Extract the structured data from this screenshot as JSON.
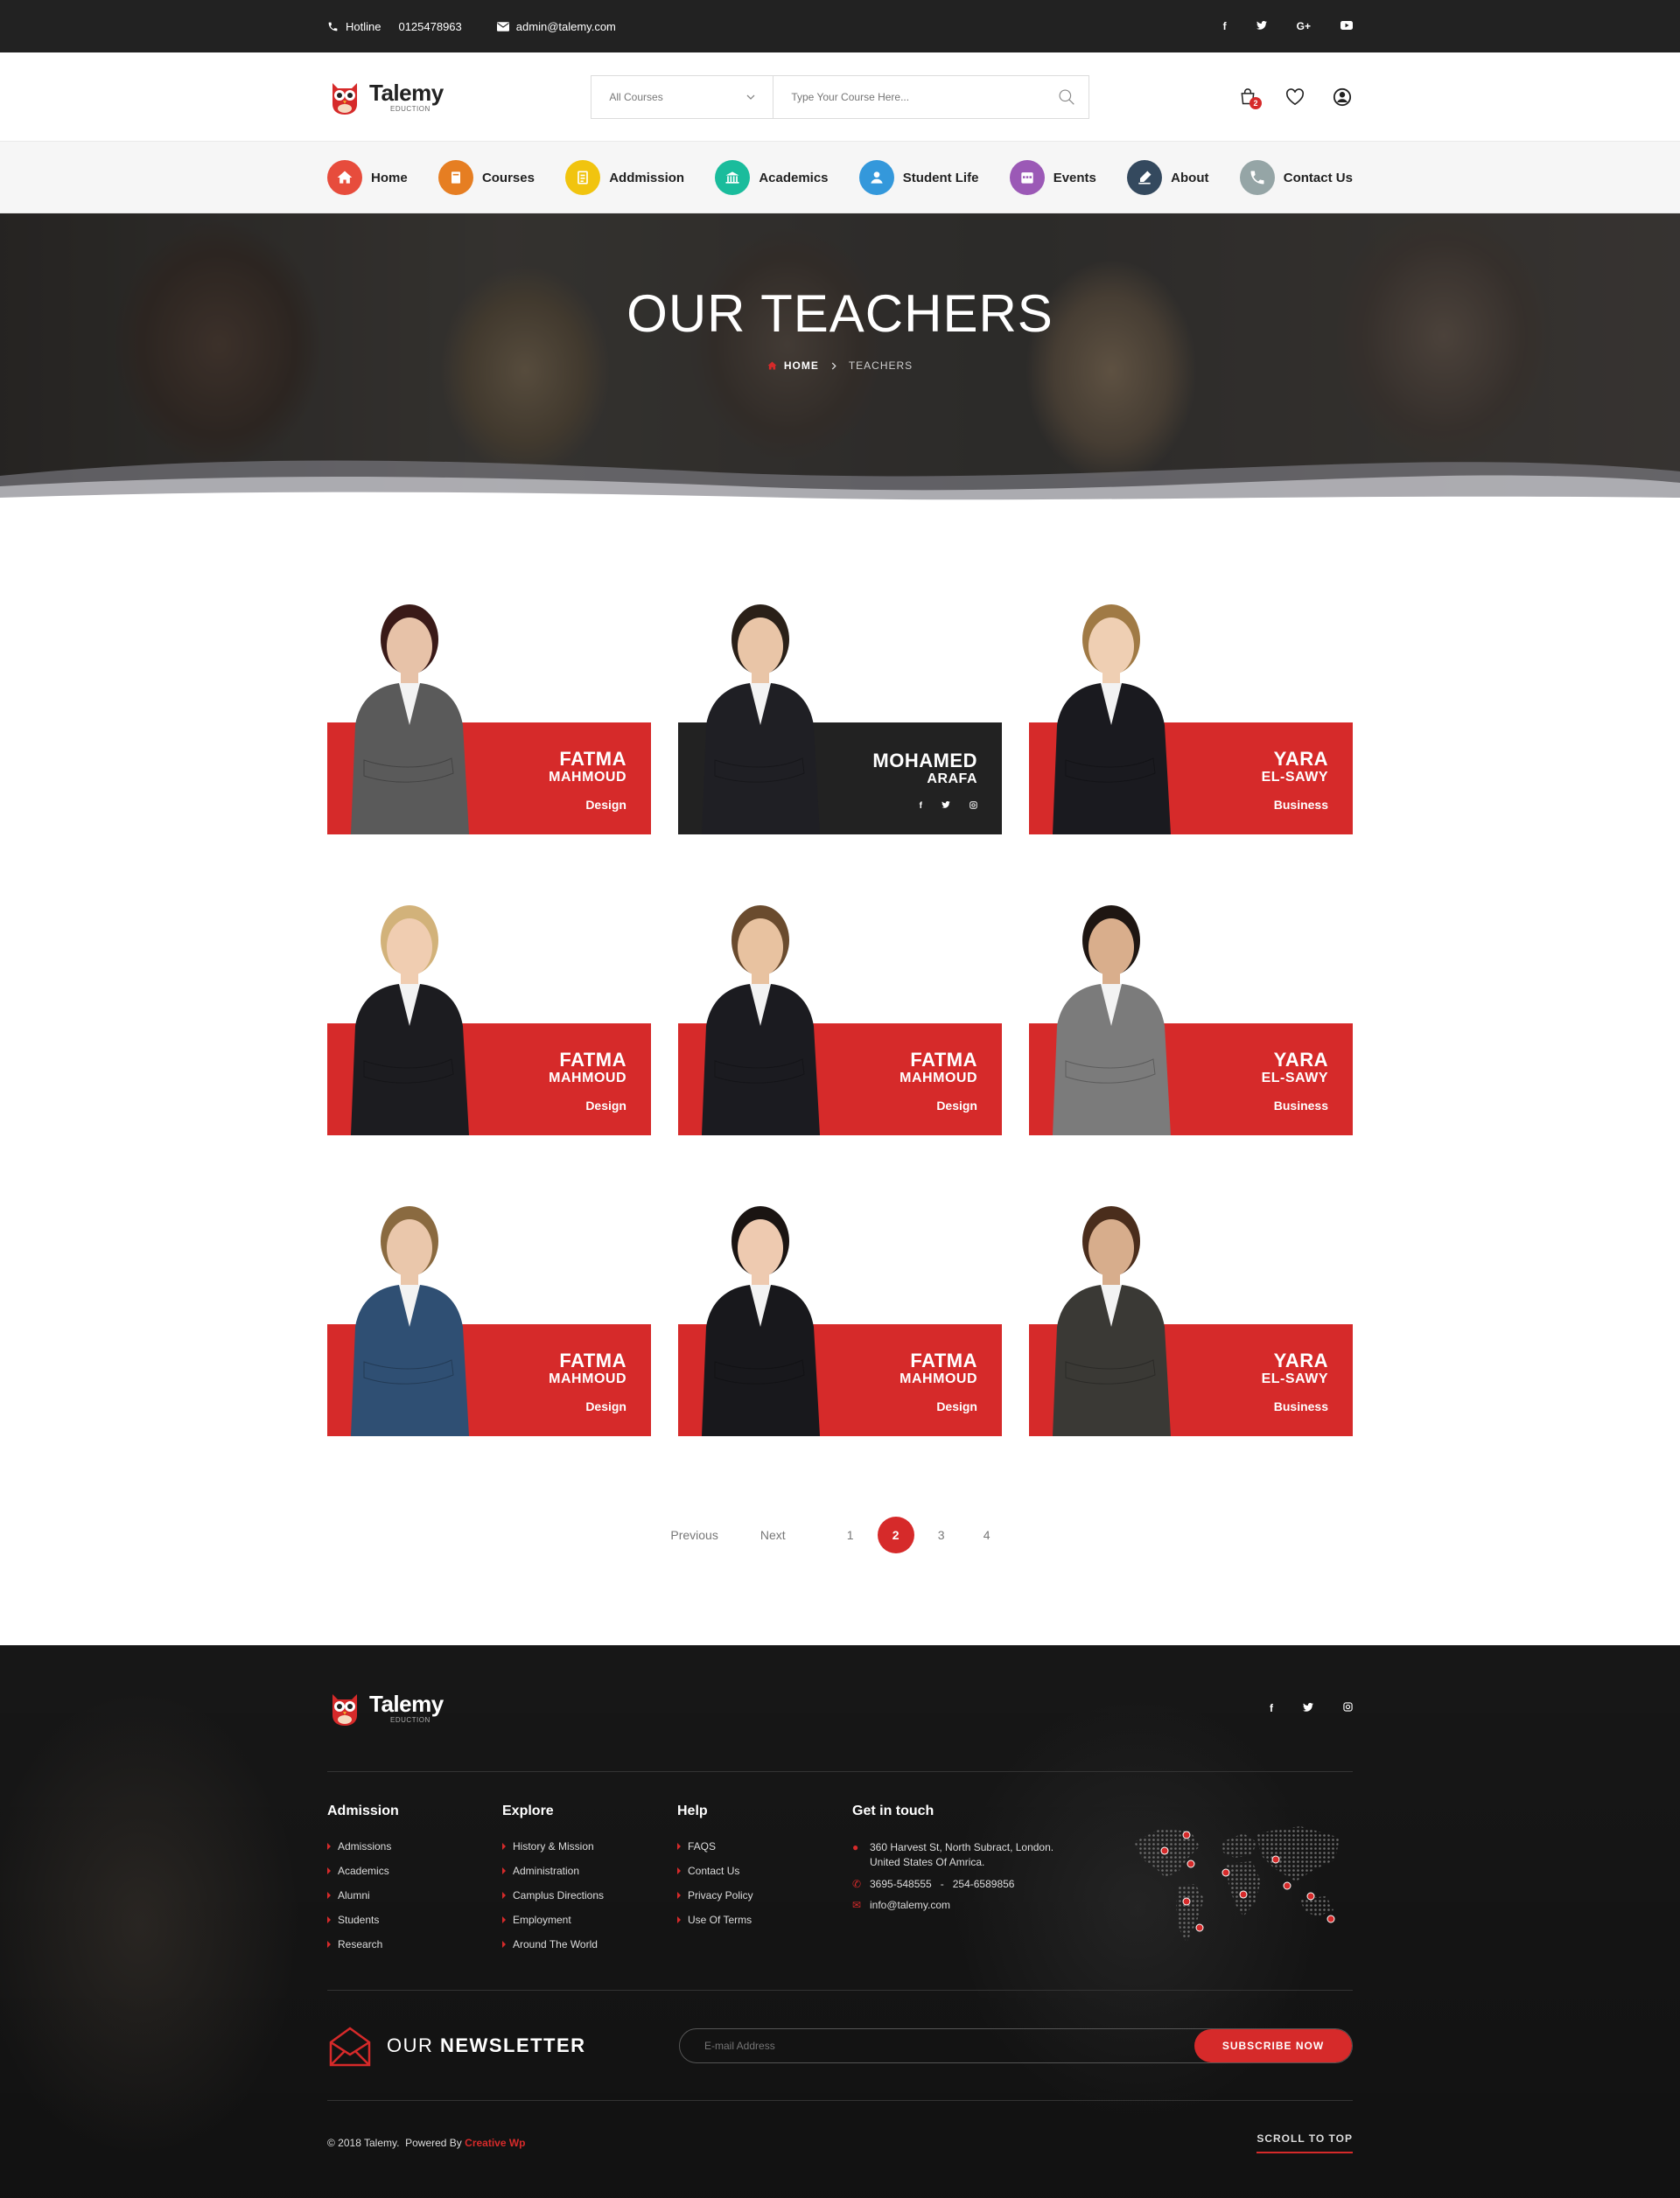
{
  "topbar": {
    "hotline_label": "Hotline",
    "hotline_number": "0125478963",
    "email": "admin@talemy.com",
    "social": [
      "f",
      "t",
      "G+",
      "yt"
    ]
  },
  "brand": {
    "name": "Talemy",
    "tagline": "EDUCTION",
    "accent": "#d62a2a"
  },
  "search": {
    "category": "All Courses",
    "placeholder": "Type Your Course Here..."
  },
  "header": {
    "cart_count": "2"
  },
  "nav": [
    {
      "label": "Home",
      "icon": "home-icon",
      "color": "#e74c3c"
    },
    {
      "label": "Courses",
      "icon": "book-icon",
      "color": "#e67e22"
    },
    {
      "label": "Addmission",
      "icon": "document-icon",
      "color": "#f1c40f"
    },
    {
      "label": "Academics",
      "icon": "building-icon",
      "color": "#1abc9c"
    },
    {
      "label": "Student Life",
      "icon": "user-icon",
      "color": "#3498db"
    },
    {
      "label": "Events",
      "icon": "calendar-icon",
      "color": "#9b59b6"
    },
    {
      "label": "About",
      "icon": "pen-icon",
      "color": "#34495e"
    },
    {
      "label": "Contact Us",
      "icon": "phone-icon",
      "color": "#95a5a6"
    }
  ],
  "hero": {
    "title": "OUR TEACHERS",
    "breadcrumb": {
      "home": "HOME",
      "current": "TEACHERS"
    }
  },
  "teachers": [
    {
      "first": "FATMA",
      "last": "MAHMOUD",
      "role": "Design",
      "style": "red"
    },
    {
      "first": "MOHAMED",
      "last": "ARAFA",
      "role": "",
      "style": "dark",
      "social": [
        "f",
        "t",
        "ig"
      ]
    },
    {
      "first": "YARA",
      "last": "EL-SAWY",
      "role": "Business",
      "style": "red"
    },
    {
      "first": "FATMA",
      "last": "MAHMOUD",
      "role": "Design",
      "style": "red"
    },
    {
      "first": "FATMA",
      "last": "MAHMOUD",
      "role": "Design",
      "style": "red"
    },
    {
      "first": "YARA",
      "last": "EL-SAWY",
      "role": "Business",
      "style": "red"
    },
    {
      "first": "FATMA",
      "last": "MAHMOUD",
      "role": "Design",
      "style": "red"
    },
    {
      "first": "FATMA",
      "last": "MAHMOUD",
      "role": "Design",
      "style": "red"
    },
    {
      "first": "YARA",
      "last": "EL-SAWY",
      "role": "Business",
      "style": "red"
    }
  ],
  "pagination": {
    "previous": "Previous",
    "next": "Next",
    "pages": [
      "1",
      "2",
      "3",
      "4"
    ],
    "current": "2"
  },
  "footer": {
    "columns": [
      {
        "title": "Admission",
        "links": [
          "Admissions",
          "Academics",
          "Alumni",
          "Students",
          "Research"
        ]
      },
      {
        "title": "Explore",
        "links": [
          "History & Mission",
          "Administration",
          "Camplus Directions",
          "Employment",
          "Around The World"
        ]
      },
      {
        "title": "Help",
        "links": [
          "FAQS",
          "Contact Us",
          "Privacy Policy",
          "Use Of Terms"
        ]
      }
    ],
    "contact": {
      "title": "Get in touch",
      "address_line1": "360 Harvest St, North Subract, London.",
      "address_line2": "United States Of Amrica.",
      "phone": "3695-548555   -   254-6589856",
      "email": "info@talemy.com"
    },
    "newsletter": {
      "title_light": "OUR ",
      "title_bold": "NEWSLETTER",
      "placeholder": "E-mail Address",
      "button": "SUBSCRIBE NOW"
    },
    "copyright": "© 2018 Talemy.  Powered By ",
    "powered_by": "Creative Wp",
    "scroll_top": "SCROLL TO TOP"
  }
}
